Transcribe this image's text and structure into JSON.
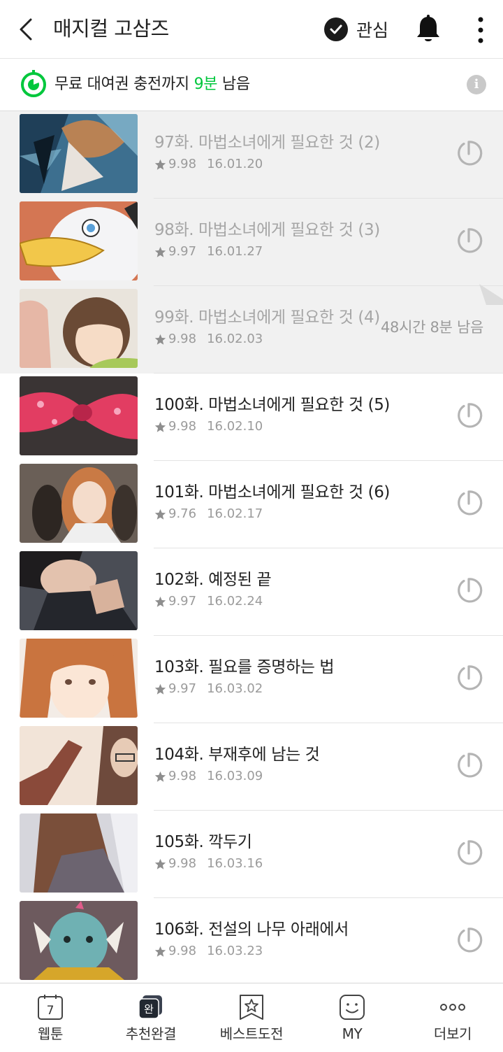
{
  "header": {
    "title": "매지컬 고삼즈",
    "favorite_label": "관심"
  },
  "info": {
    "prefix": "무료 대여권 충전까지",
    "time": "9분",
    "suffix": "남음"
  },
  "colors": {
    "accent": "#00c73c",
    "read_row_bg": "#f1f1f1"
  },
  "episodes": [
    {
      "title": "97화. 마법소녀에게 필요한 것 (2)",
      "rating": "9.98",
      "date": "16.01.20",
      "read": true,
      "status_icon": "rental-timer-icon"
    },
    {
      "title": "98화. 마법소녀에게 필요한 것 (3)",
      "rating": "9.97",
      "date": "16.01.27",
      "read": true,
      "status_icon": "rental-timer-icon"
    },
    {
      "title": "99화. 마법소녀에게 필요한 것 (4)",
      "rating": "9.98",
      "date": "16.02.03",
      "read": true,
      "remaining": "48시간 8분 남음"
    },
    {
      "title": "100화. 마법소녀에게 필요한 것 (5)",
      "rating": "9.98",
      "date": "16.02.10",
      "read": false,
      "status_icon": "rental-timer-icon"
    },
    {
      "title": "101화. 마법소녀에게 필요한 것 (6)",
      "rating": "9.76",
      "date": "16.02.17",
      "read": false,
      "status_icon": "rental-timer-icon"
    },
    {
      "title": "102화. 예정된 끝",
      "rating": "9.97",
      "date": "16.02.24",
      "read": false,
      "status_icon": "rental-timer-icon"
    },
    {
      "title": "103화. 필요를 증명하는 법",
      "rating": "9.97",
      "date": "16.03.02",
      "read": false,
      "status_icon": "rental-timer-icon"
    },
    {
      "title": "104화. 부재후에 남는 것",
      "rating": "9.98",
      "date": "16.03.09",
      "read": false,
      "status_icon": "rental-timer-icon"
    },
    {
      "title": "105화. 깍두기",
      "rating": "9.98",
      "date": "16.03.16",
      "read": false,
      "status_icon": "rental-timer-icon"
    },
    {
      "title": "106화. 전설의 나무 아래에서",
      "rating": "9.98",
      "date": "16.03.23",
      "read": false,
      "status_icon": "rental-timer-icon"
    }
  ],
  "nav": {
    "webtoon_day": "7",
    "webtoon": "웹툰",
    "recommend_badge": "완",
    "recommend": "추천완결",
    "best": "베스트도전",
    "my": "MY",
    "more": "더보기"
  }
}
